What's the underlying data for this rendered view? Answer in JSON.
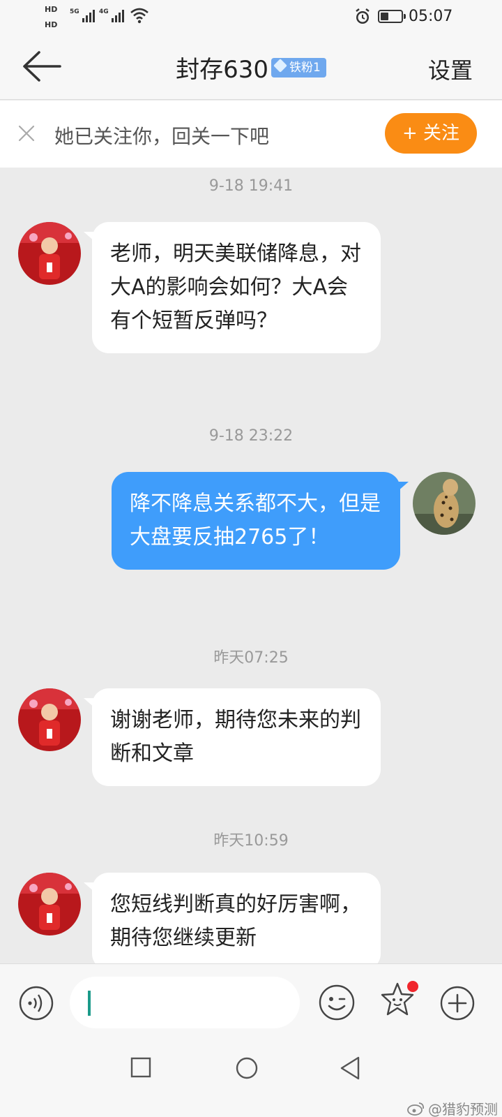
{
  "status_bar": {
    "hd1": "HD",
    "hd2": "HD",
    "net1_label": "5G",
    "net2_label": "4G",
    "time": "05:07",
    "icons": [
      "signal-icon",
      "wifi-icon",
      "alarm-icon",
      "battery-icon"
    ]
  },
  "header": {
    "title": "封存630",
    "fan_badge": "铁粉1",
    "settings_label": "设置",
    "back_icon": "back-arrow-icon"
  },
  "follow_banner": {
    "text": "她已关注你，回关一下吧",
    "button_label": "+ 关注",
    "accent": "#fa8c14"
  },
  "messages": [
    {
      "timestamp": "9-18 19:41",
      "direction": "incoming",
      "text": "老师，明天美联储降息，对大A的影响会如何？大A会有个短暂反弹吗？"
    },
    {
      "timestamp": "9-18 23:22",
      "direction": "outgoing",
      "text": "降不降息关系都不大，但是大盘要反抽2765了！"
    },
    {
      "timestamp": "昨天07:25",
      "direction": "incoming",
      "text": "谢谢老师，期待您未来的判断和文章"
    },
    {
      "timestamp": "昨天10:59",
      "direction": "incoming",
      "text": "您短线判断真的好厉害啊，期待您继续更新"
    }
  ],
  "colors": {
    "outgoing_bubble": "#3f9dfb",
    "incoming_bubble": "#ffffff",
    "chat_background": "#ebebeb"
  },
  "input_bar": {
    "value": "",
    "icons": [
      "voice-icon",
      "emoji-icon",
      "sticker-icon",
      "plus-icon"
    ]
  },
  "watermark": "@猎豹预测"
}
